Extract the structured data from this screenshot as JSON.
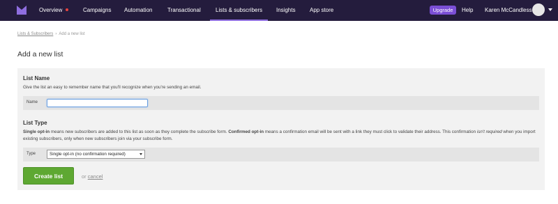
{
  "nav": {
    "logo": "mailchimp-logo-icon",
    "items": [
      "Overview",
      "Campaigns",
      "Automation",
      "Transactional",
      "Lists & subscribers",
      "Insights",
      "App store"
    ],
    "upgrade": "Upgrade",
    "help": "Help",
    "user": "Karen McCandless",
    "colors": {
      "background": "#241c3d",
      "active_underline": "#8f6ee0",
      "upgrade": "#7b4fd6",
      "notification_dot": "#e8443f"
    }
  },
  "breadcrumb": {
    "link": "Lists & Subscribers",
    "separator": "›",
    "current": "Add a new list"
  },
  "page_title": "Add a new list",
  "list_name": {
    "heading": "List Name",
    "description": "Give the list an easy to remember name that you'll recognize when you're sending an email.",
    "field_label": "Name",
    "value": ""
  },
  "list_type": {
    "heading": "List Type",
    "desc_parts": {
      "single": "Single opt-in",
      "p1": " means new subscribers are added to this list as soon as they complete the subscribe form. ",
      "confirmed": "Confirmed opt-in",
      "p2": " means a confirmation email will be sent with a link they must click to validate their address. This confirmation ",
      "not_required": "isn't required",
      "p3": " when you import existing subscribers, only when new subscribers join via your subscribe form."
    },
    "field_label": "Type",
    "selected": "Single opt-in (no confirmation required)"
  },
  "actions": {
    "create": "Create list",
    "or": "or",
    "cancel": "cancel",
    "create_color": "#5ea832"
  }
}
